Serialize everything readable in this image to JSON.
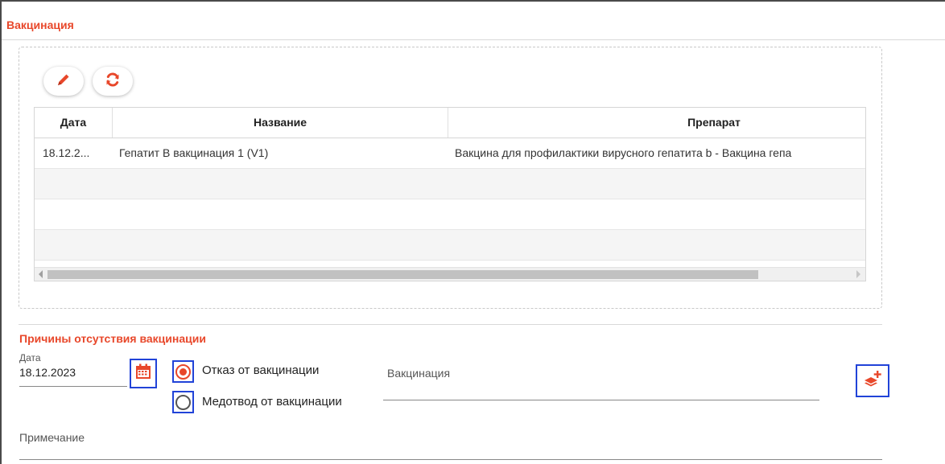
{
  "vaccination": {
    "title": "Вакцинация",
    "toolbar": {
      "edit_icon": "pencil-icon",
      "refresh_icon": "refresh-icon"
    },
    "table": {
      "columns": [
        "Дата",
        "Название",
        "Препарат"
      ],
      "rows": [
        [
          "18.12.2...",
          "Гепатит B вакцинация 1 (V1)",
          "Вакцина для профилактики вирусного гепатита b - Вакцина гепа"
        ],
        [
          "",
          "",
          ""
        ],
        [
          "",
          "",
          ""
        ],
        [
          "",
          "",
          ""
        ]
      ]
    }
  },
  "absence": {
    "title": "Причины отсутствия вакцинации",
    "date_label": "Дата",
    "date_value": "18.12.2023",
    "calendar_icon": "calendar-icon",
    "options": [
      {
        "label": "Отказ от вакцинации",
        "checked": true
      },
      {
        "label": "Медотвод от вакцинации",
        "checked": false
      }
    ],
    "vaccination_label": "Вакцинация",
    "add_icon": "add-layer-icon",
    "note_label": "Примечание"
  },
  "colors": {
    "accent": "#e8472a",
    "highlight": "#2143d8"
  }
}
